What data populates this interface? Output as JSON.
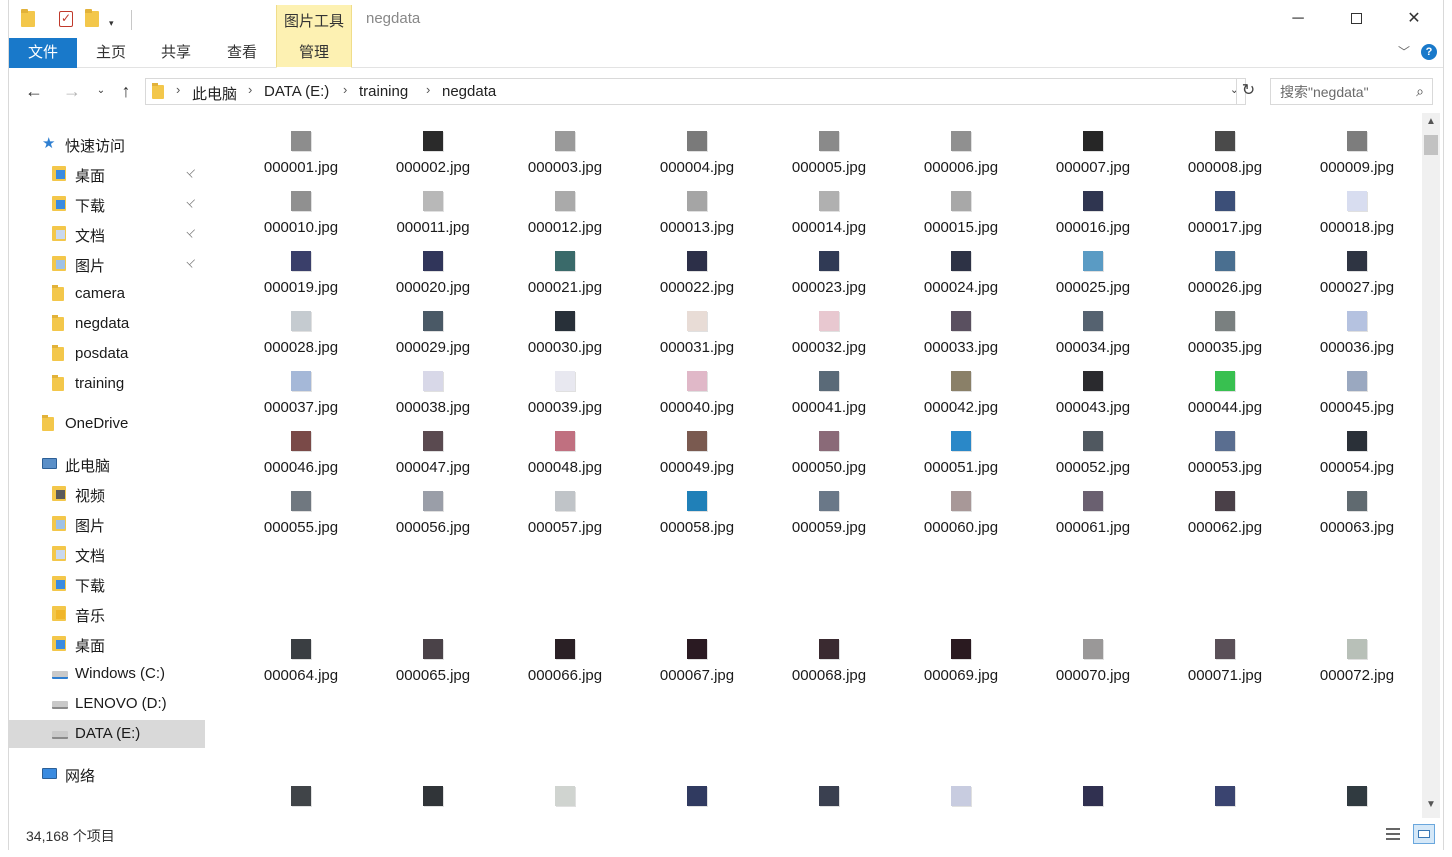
{
  "window": {
    "title": "negdata",
    "context_tool_group": "图片工具",
    "controls": {
      "minimize": "─",
      "close": "✕"
    }
  },
  "quick_access_toolbar": {
    "dropdown_glyph": "▾",
    "properties_glyph": "✓"
  },
  "ribbon": {
    "tabs": [
      "文件",
      "主页",
      "共享",
      "查看",
      "管理"
    ],
    "expand_glyph": "﹀",
    "help_glyph": "?"
  },
  "navigation": {
    "back_glyph": "←",
    "forward_glyph": "→",
    "recent_glyph": "⌄",
    "up_glyph": "↑",
    "refresh_glyph": "↻",
    "address_dropdown_glyph": "⌄"
  },
  "address": {
    "breadcrumbs": [
      "此电脑",
      "DATA (E:)",
      "training",
      "negdata"
    ],
    "separator": "›"
  },
  "search": {
    "placeholder": "搜索\"negdata\"",
    "icon_glyph": "⌕"
  },
  "nav_pane": {
    "items": [
      {
        "label": "快速访问",
        "icon": "star-icon",
        "pinned": false,
        "selected": false
      },
      {
        "label": "桌面",
        "icon": "desktop-icon",
        "pinned": true,
        "selected": false
      },
      {
        "label": "下载",
        "icon": "download-icon",
        "pinned": true,
        "selected": false
      },
      {
        "label": "文档",
        "icon": "document-icon",
        "pinned": true,
        "selected": false
      },
      {
        "label": "图片",
        "icon": "pictures-icon",
        "pinned": true,
        "selected": false
      },
      {
        "label": "camera",
        "icon": "folder-icon",
        "pinned": false,
        "selected": false
      },
      {
        "label": "negdata",
        "icon": "folder-icon",
        "pinned": false,
        "selected": false
      },
      {
        "label": "posdata",
        "icon": "folder-icon",
        "pinned": false,
        "selected": false
      },
      {
        "label": "training",
        "icon": "folder-icon",
        "pinned": false,
        "selected": false
      },
      {
        "label": "OneDrive",
        "icon": "folder-icon",
        "pinned": false,
        "selected": false
      },
      {
        "label": "此电脑",
        "icon": "computer-icon",
        "pinned": false,
        "selected": false
      },
      {
        "label": "视频",
        "icon": "video-icon",
        "pinned": false,
        "selected": false
      },
      {
        "label": "图片",
        "icon": "pictures-icon",
        "pinned": false,
        "selected": false
      },
      {
        "label": "文档",
        "icon": "document-icon",
        "pinned": false,
        "selected": false
      },
      {
        "label": "下载",
        "icon": "download-icon",
        "pinned": false,
        "selected": false
      },
      {
        "label": "音乐",
        "icon": "music-icon",
        "pinned": false,
        "selected": false
      },
      {
        "label": "桌面",
        "icon": "desktop-icon",
        "pinned": false,
        "selected": false
      },
      {
        "label": "Windows (C:)",
        "icon": "windows-drive-icon",
        "pinned": false,
        "selected": false
      },
      {
        "label": "LENOVO (D:)",
        "icon": "drive-icon",
        "pinned": false,
        "selected": false
      },
      {
        "label": "DATA (E:)",
        "icon": "drive-icon",
        "pinned": false,
        "selected": true
      },
      {
        "label": "网络",
        "icon": "network-icon",
        "pinned": false,
        "selected": false
      }
    ],
    "pin_glyph": "📌"
  },
  "files": {
    "names": [
      "000001.jpg",
      "000002.jpg",
      "000003.jpg",
      "000004.jpg",
      "000005.jpg",
      "000006.jpg",
      "000007.jpg",
      "000008.jpg",
      "000009.jpg",
      "000010.jpg",
      "000011.jpg",
      "000012.jpg",
      "000013.jpg",
      "000014.jpg",
      "000015.jpg",
      "000016.jpg",
      "000017.jpg",
      "000018.jpg",
      "000019.jpg",
      "000020.jpg",
      "000021.jpg",
      "000022.jpg",
      "000023.jpg",
      "000024.jpg",
      "000025.jpg",
      "000026.jpg",
      "000027.jpg",
      "000028.jpg",
      "000029.jpg",
      "000030.jpg",
      "000031.jpg",
      "000032.jpg",
      "000033.jpg",
      "000034.jpg",
      "000035.jpg",
      "000036.jpg",
      "000037.jpg",
      "000038.jpg",
      "000039.jpg",
      "000040.jpg",
      "000041.jpg",
      "000042.jpg",
      "000043.jpg",
      "000044.jpg",
      "000045.jpg",
      "000046.jpg",
      "000047.jpg",
      "000048.jpg",
      "000049.jpg",
      "000050.jpg",
      "000051.jpg",
      "000052.jpg",
      "000053.jpg",
      "000054.jpg",
      "000055.jpg",
      "000056.jpg",
      "000057.jpg",
      "000058.jpg",
      "000059.jpg",
      "000060.jpg",
      "000061.jpg",
      "000062.jpg",
      "000063.jpg",
      "000064.jpg",
      "000065.jpg",
      "000066.jpg",
      "000067.jpg",
      "000068.jpg",
      "000069.jpg",
      "000070.jpg",
      "000071.jpg",
      "000072.jpg"
    ],
    "thumb_colors": [
      "#8d8d8d",
      "#2a2a2a",
      "#9a9a9a",
      "#7a7a7a",
      "#8a8a8a",
      "#909090",
      "#262626",
      "#4a4a4a",
      "#7d7d7d",
      "#909090",
      "#b8b8b8",
      "#aaaaaa",
      "#a5a5a5",
      "#b0b0b0",
      "#a8a8a8",
      "#2f3550",
      "#3c4f78",
      "#d8ddf0",
      "#3a3f6a",
      "#30355a",
      "#3a6a6a",
      "#2c2f48",
      "#303a55",
      "#2d3245",
      "#5a9bc4",
      "#4a6f90",
      "#2e3442",
      "#c5cbd0",
      "#4a5966",
      "#283039",
      "#e8dcd6",
      "#e8c8d0",
      "#5a5060",
      "#556270",
      "#7a8080",
      "#b5c2e0",
      "#a5b8d8",
      "#d8d8e8",
      "#e8e8f0",
      "#e0b8c8",
      "#5a6a78",
      "#8a8068",
      "#2a2a2e",
      "#38c050",
      "#9aa8c0",
      "#7a4a48",
      "#5a4a50",
      "#c07080",
      "#7a5a50",
      "#8a6a78",
      "#2a88c8",
      "#505860",
      "#5a6e90",
      "#2a3038",
      "#707880",
      "#9a9ea8",
      "#c0c4c8",
      "#2080b8",
      "#6a7888",
      "#a89898",
      "#6a6070",
      "#4a4048",
      "#606a70",
      "#3a3e42",
      "#4a4248",
      "#2a2025",
      "#2a1a22",
      "#3a2a30",
      "#2a1a20",
      "#9a9898",
      "#5a5058",
      "#b8c0b8"
    ],
    "partial_row_colors": [
      "#404448",
      "#303438",
      "#d0d4d0",
      "#303a60",
      "#3a4050",
      "#c8cce0",
      "#303050",
      "#3a4470",
      "#303a40"
    ]
  },
  "status": {
    "item_count": "34,168 个项目"
  }
}
